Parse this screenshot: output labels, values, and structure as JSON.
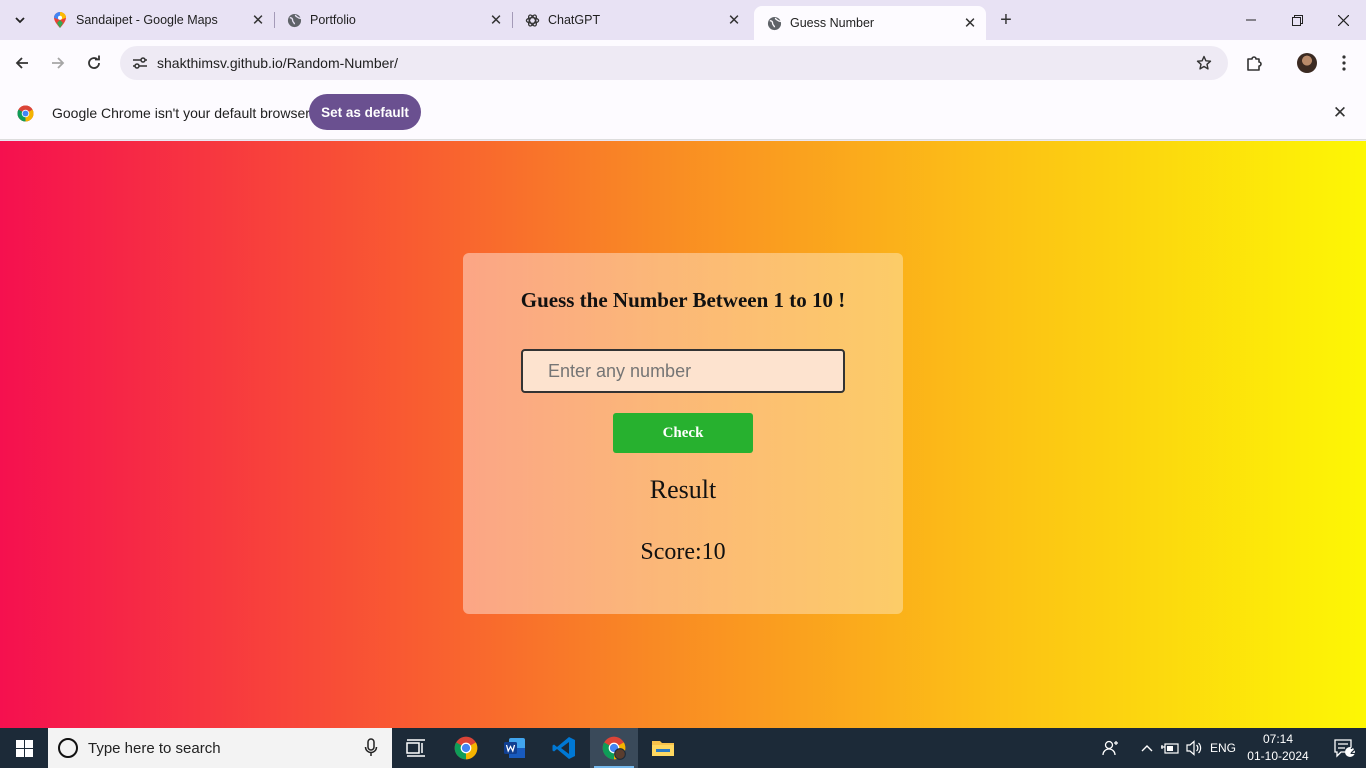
{
  "browser": {
    "tabs": [
      {
        "title": "Sandaipet - Google Maps",
        "icon": "google-maps-icon",
        "active": false
      },
      {
        "title": "Portfolio",
        "icon": "globe-icon",
        "active": false
      },
      {
        "title": "ChatGPT",
        "icon": "chatgpt-icon",
        "active": false
      },
      {
        "title": "Guess Number",
        "icon": "globe-icon",
        "active": true
      }
    ],
    "url": "shakthimsv.github.io/Random-Number/",
    "infobar": {
      "message": "Google Chrome isn't your default browser",
      "button": "Set as default"
    }
  },
  "page": {
    "heading": "Guess the Number Between 1 to 10 !",
    "input_placeholder": "Enter any number",
    "input_value": "",
    "check_button": "Check",
    "result": "Result",
    "score": "Score:10"
  },
  "colors": {
    "gradient_start": "#f5104f",
    "gradient_end": "#fdf704",
    "check_button": "#27b12f",
    "default_button": "#6a5090"
  },
  "taskbar": {
    "search_placeholder": "Type here to search",
    "language": "ENG",
    "time": "07:14",
    "date": "01-10-2024",
    "notification_count": "2"
  }
}
